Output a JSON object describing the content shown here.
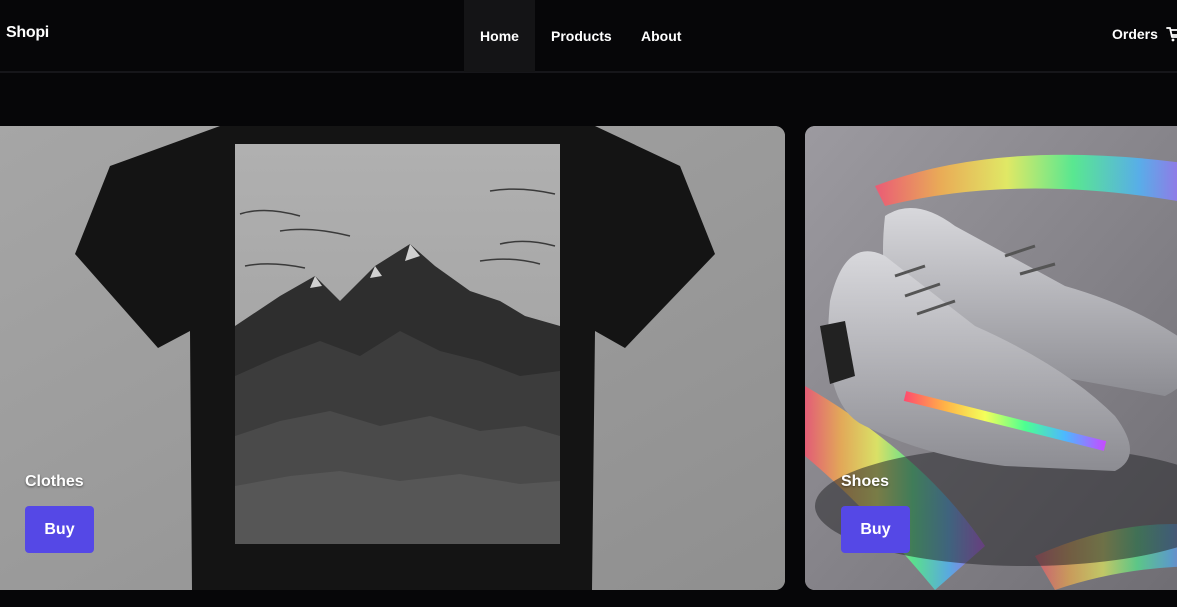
{
  "nav": {
    "logo": "Shopi",
    "links": [
      "Home",
      "Products",
      "About"
    ],
    "active": "Home",
    "orders": "Orders",
    "cart_icon": "cart-icon"
  },
  "cards": [
    {
      "title": "Clothes",
      "button": "Buy"
    },
    {
      "title": "Shoes",
      "button": "Buy"
    }
  ],
  "colors": {
    "background": "#060608",
    "nav_active_bg": "#141416",
    "buy_button": "#5548e6",
    "text": "#ffffff"
  }
}
